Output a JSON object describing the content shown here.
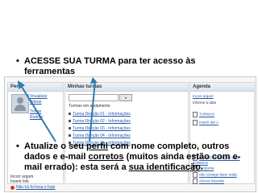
{
  "bullet1": {
    "text": "ACESSE SUA TURMA para ter acesso às ferramentas"
  },
  "bullet2": {
    "part1": "Atualize o seu ",
    "perfil": "perfil",
    "part2": " com nome completo, outros dados e e-mail ",
    "corretos": "corretos",
    "part3": " (muitos ainda estão com e-mail errado): esta será a ",
    "identificacao": "sua identificação",
    "part4": "."
  },
  "moodle": {
    "profile": {
      "title": "Perfil",
      "links": [
        "Visualizar",
        "Alterar",
        "Trocar",
        "Rodopi"
      ],
      "footer1": "Incorr argum",
      "footer2": "Inserir link",
      "footer3": "Não há foi lesa o hoje"
    },
    "courses": {
      "title": "Minhas turmas",
      "search_btn": "Ir",
      "section": "Turmas em andamento",
      "rows": [
        "Turma Direção 01 - Informações",
        "Turma Direção 02 - Informações",
        "Turma Direção 03 - Informações",
        "Turma Direção 04 - Informações",
        "Turma Direção 05 - Informações"
      ]
    },
    "side": {
      "title": "Agenda",
      "rows": [
        "Incorr argum",
        "Informe a data",
        "TURMAS",
        "Inserir até o",
        "REPRESENTAÇÃO DAS TURMAS",
        "Pergunta",
        "não consigo fazer nada",
        "Alunos fazendo"
      ]
    }
  },
  "colors": {
    "accent": "#2255aa",
    "arrow": "#2e7bb0"
  }
}
